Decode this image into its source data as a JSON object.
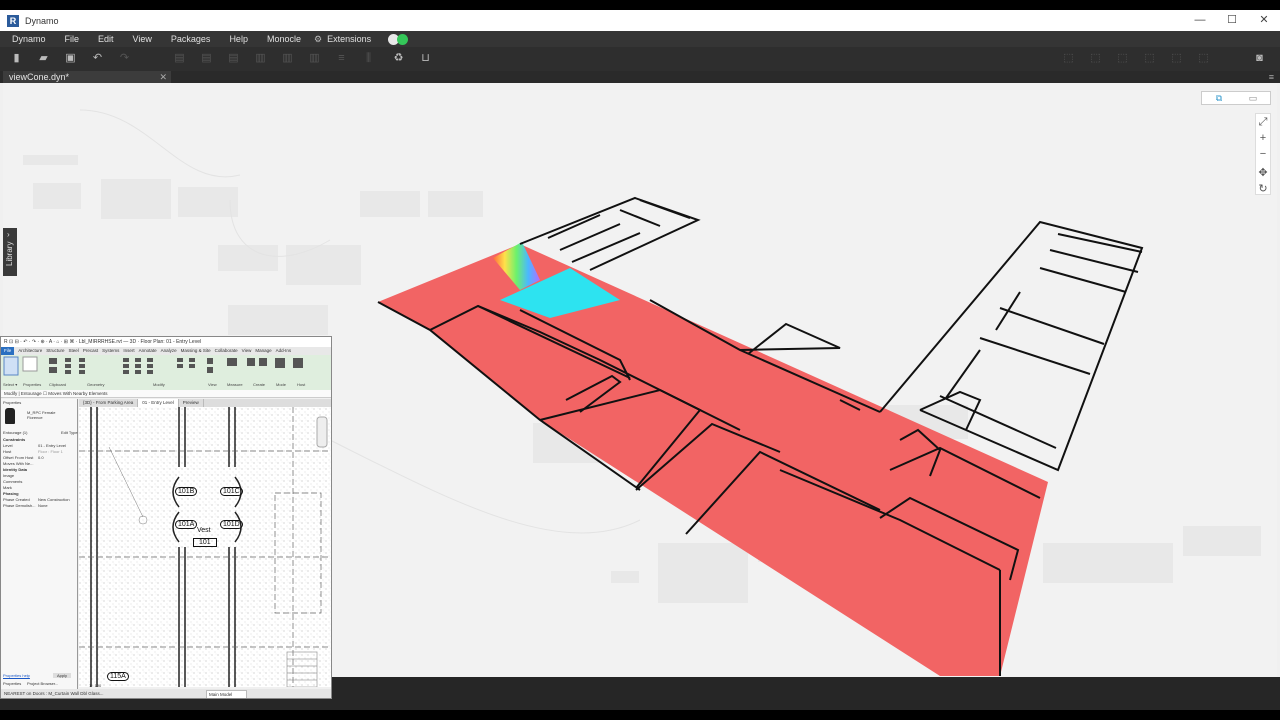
{
  "window": {
    "title": "Dynamo",
    "app_icon": "R",
    "controls": {
      "minimize": "—",
      "maximize": "☐",
      "close": "✕"
    }
  },
  "menu": {
    "items": [
      "Dynamo",
      "File",
      "Edit",
      "View",
      "Packages",
      "Help",
      "Monocle",
      "Extensions"
    ],
    "status_colors": [
      "#e8e8e8",
      "#34c759"
    ]
  },
  "tabs": {
    "active": "viewCone.dyn*",
    "close": "✕",
    "menu": "≡"
  },
  "canvas": {
    "library_label": "Library",
    "view_toggle": [
      "⧉",
      "▭"
    ],
    "zoom_controls": [
      "⤢",
      "+",
      "−",
      "✥",
      "↻"
    ],
    "colors": {
      "floor": "#f26464",
      "view_area": "#2de3f0",
      "background": "#f2f2f2"
    }
  },
  "revit": {
    "title": "R  ⊡ ⊟ ·  ↶ · ↷ ·  ⊕ ·  A  ·  ⌂ ·  ⊞  ⌘  ·  Lbl_MIRRRHSE.rvt — 3D  ·  Floor Plan: 01 - Entry Level",
    "ribbon_tabs": [
      "File",
      "Architecture",
      "Structure",
      "Steel",
      "Precast",
      "Systems",
      "Insert",
      "Annotate",
      "Analyze",
      "Massing & Site",
      "Collaborate",
      "View",
      "Manage",
      "Add-Ins"
    ],
    "ribbon_groups": [
      "Select ▾",
      "Properties",
      "Clipboard",
      "Geometry",
      "Modify",
      "View",
      "Measure",
      "Create",
      "Mode",
      "Host"
    ],
    "subbar": "Modify | Entourage     ☐ Moves With Nearby Elements",
    "properties": {
      "header": "Properties",
      "family": "M_RPC Female",
      "family_sub": "Florence",
      "type_label": "Entourage (1)",
      "edit_type": "Edit Type",
      "rows": [
        [
          "Constraints",
          ""
        ],
        [
          "Level",
          "01 - Entry Level"
        ],
        [
          "Host",
          "Floor : Floor 1"
        ],
        [
          "Offset From Host",
          "0.0"
        ],
        [
          "Moves With Ne...",
          ""
        ],
        [
          "Identity Data",
          ""
        ],
        [
          "Image",
          ""
        ],
        [
          "Comments",
          ""
        ],
        [
          "Mark",
          ""
        ],
        [
          "Phasing",
          ""
        ],
        [
          "Phase Created",
          "New Construction"
        ],
        [
          "Phase Demolish...",
          "None"
        ]
      ],
      "help_link": "Properties help",
      "apply": "Apply",
      "bottom_tabs": [
        "Properties",
        "Project Browser..."
      ]
    },
    "view_tabs": [
      "{3D} - From Parking Area",
      "01 - Entry Level",
      "Preview"
    ],
    "tags": [
      "101B",
      "101C",
      "101A",
      "101D",
      "Vest",
      "101",
      "115A"
    ],
    "view_scale": "1 : 100",
    "model_selector": "Main Model",
    "status": "NEAREST on Doors : M_Curtain Wall Dbl Glass..."
  }
}
